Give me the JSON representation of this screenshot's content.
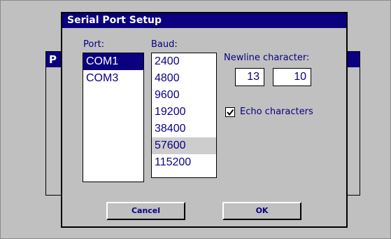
{
  "background_window": {
    "title": "P"
  },
  "dialog": {
    "title": "Serial Port Setup"
  },
  "port": {
    "label": "Port:",
    "items": [
      {
        "label": "COM1",
        "selected": true
      },
      {
        "label": "COM3",
        "selected": false
      }
    ]
  },
  "baud": {
    "label": "Baud:",
    "items": [
      {
        "label": "2400"
      },
      {
        "label": "4800"
      },
      {
        "label": "9600"
      },
      {
        "label": "19200"
      },
      {
        "label": "38400"
      },
      {
        "label": "57600",
        "highlighted": true
      },
      {
        "label": "115200"
      }
    ]
  },
  "newline": {
    "label": "Newline character:",
    "value1": "13",
    "value2": "10"
  },
  "echo": {
    "label": "Echo characters",
    "checked": true
  },
  "buttons": {
    "cancel": "Cancel",
    "ok": "OK"
  },
  "colors": {
    "title_bar": "#0a0080",
    "text": "#0a0080",
    "dialog_bg": "#c0c0c0",
    "highlight_row": "#cdcdcd"
  },
  "icons": {
    "checkmark": "check-icon"
  }
}
